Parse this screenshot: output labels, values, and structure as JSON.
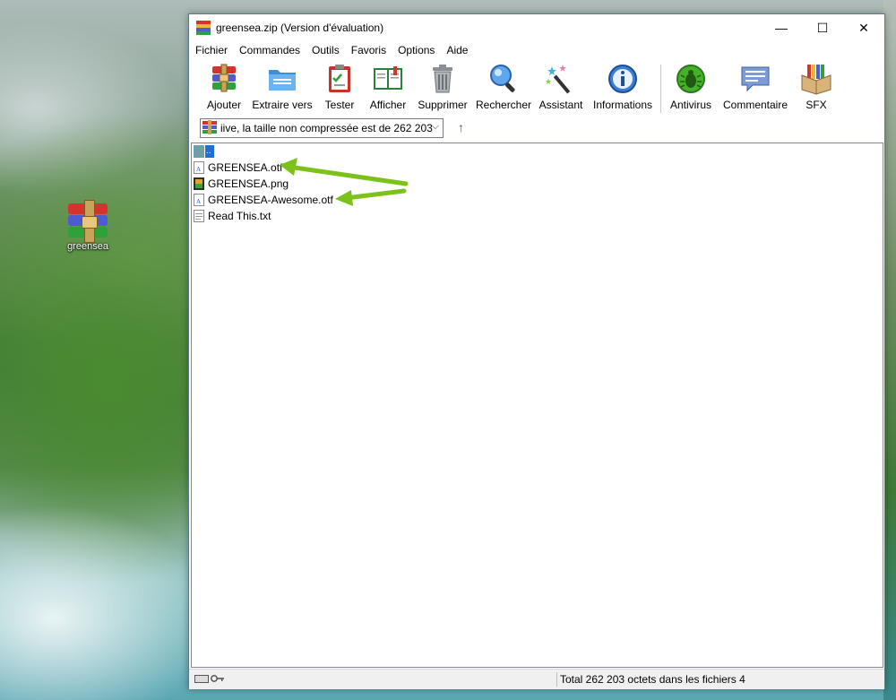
{
  "desktop": {
    "icon_label": "greensea",
    "icon": "winrar-archive-icon"
  },
  "window": {
    "title": "greensea.zip (Version d'évaluation)",
    "controls": {
      "minimize": "—",
      "maximize": "☐",
      "close": "✕"
    }
  },
  "menu": [
    "Fichier",
    "Commandes",
    "Outils",
    "Favoris",
    "Options",
    "Aide"
  ],
  "toolbar": {
    "buttons": [
      {
        "label": "Ajouter",
        "icon": "add-archive-icon"
      },
      {
        "label": "Extraire vers",
        "icon": "extract-folder-icon"
      },
      {
        "label": "Tester",
        "icon": "test-clipboard-icon"
      },
      {
        "label": "Afficher",
        "icon": "view-book-icon"
      },
      {
        "label": "Supprimer",
        "icon": "trash-icon"
      },
      {
        "label": "Rechercher",
        "icon": "search-icon"
      },
      {
        "label": "Assistant",
        "icon": "wizard-wand-icon"
      },
      {
        "label": "Informations",
        "icon": "info-icon"
      },
      {
        "label": "Antivirus",
        "icon": "antivirus-bug-icon"
      },
      {
        "label": "Commentaire",
        "icon": "comment-icon"
      },
      {
        "label": "SFX",
        "icon": "sfx-box-icon"
      }
    ]
  },
  "address": {
    "text": "iive, la taille non compressée est de 262 203",
    "dropdown": "⌵",
    "up": "↑"
  },
  "files": [
    {
      "name": "..",
      "icon": "parent-folder-icon"
    },
    {
      "name": "GREENSEA.otf",
      "icon": "font-file-icon"
    },
    {
      "name": "GREENSEA.png",
      "icon": "image-file-icon"
    },
    {
      "name": "GREENSEA-Awesome.otf",
      "icon": "font-file-icon"
    },
    {
      "name": "Read This.txt",
      "icon": "text-file-icon"
    }
  ],
  "status": {
    "text": "Total 262 203 octets dans les fichiers 4"
  },
  "colors": {
    "arrow": "#7cc21a",
    "title_bg": "#ffffff",
    "status_bg": "#f0f0f0"
  }
}
